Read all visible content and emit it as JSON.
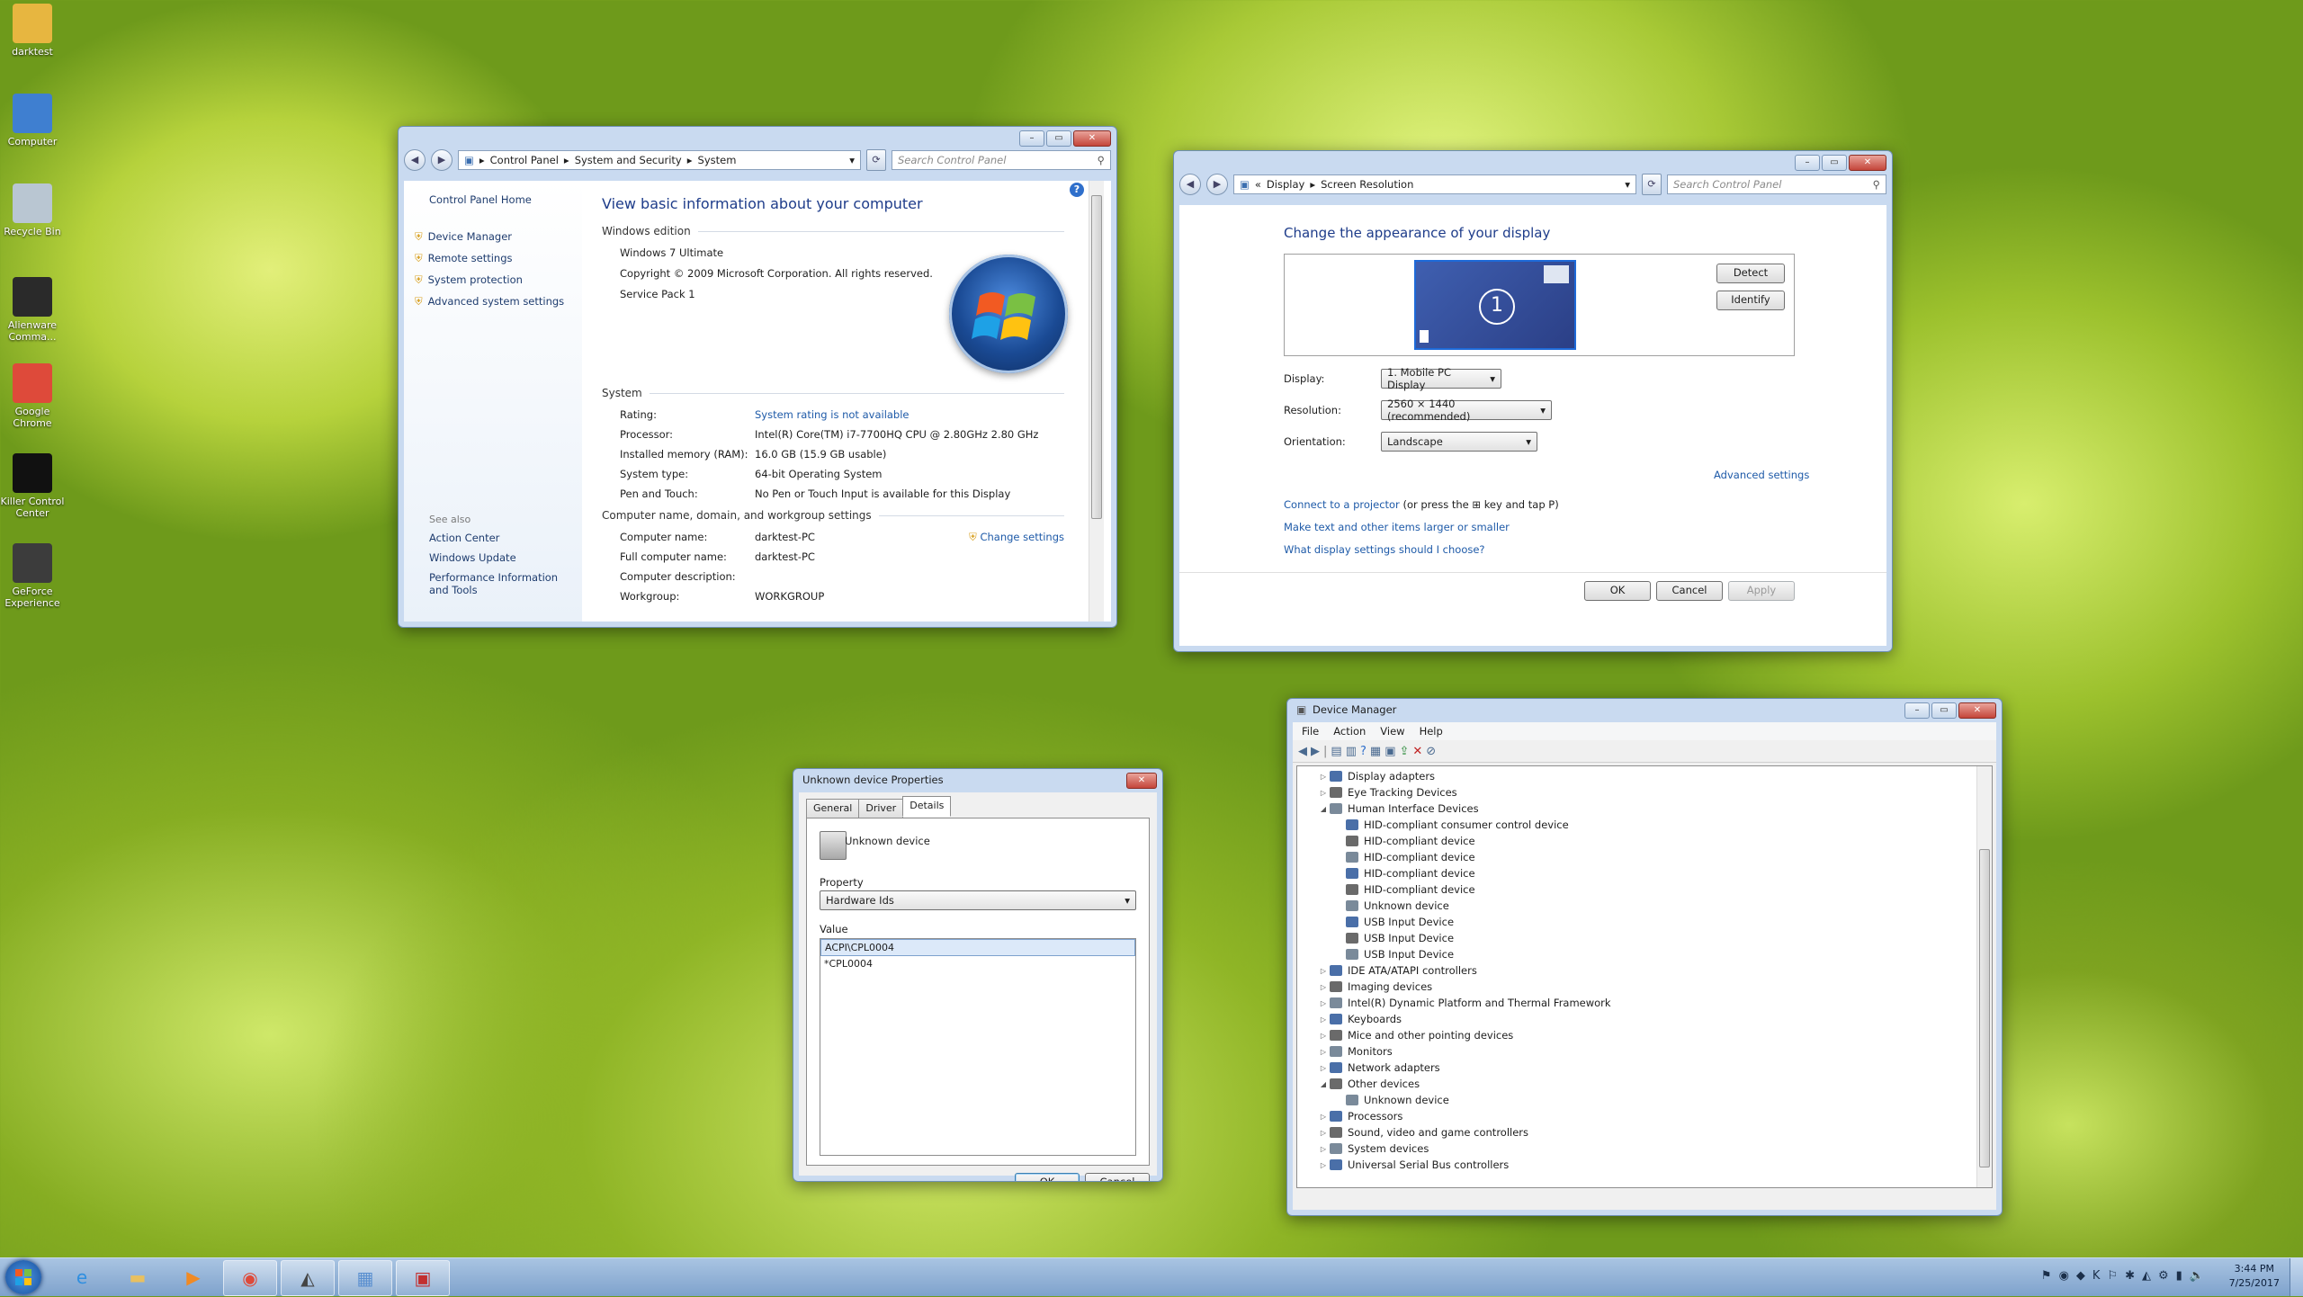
{
  "desktop_icons": [
    {
      "label": "darktest",
      "icon": "user-folder-icon",
      "color": "#e7b640"
    },
    {
      "label": "Computer",
      "icon": "computer-icon",
      "color": "#3f7fd0"
    },
    {
      "label": "Recycle Bin",
      "icon": "recycle-bin-icon",
      "color": "#b9c6d2"
    },
    {
      "label": "Alienware Comma...",
      "icon": "alienware-icon",
      "color": "#2a2a2a"
    },
    {
      "label": "Google Chrome",
      "icon": "chrome-icon",
      "color": "#de4a3a"
    },
    {
      "label": "Killer Control Center",
      "icon": "killer-icon",
      "color": "#111111"
    },
    {
      "label": "GeForce Experience",
      "icon": "geforce-icon",
      "color": "#3c3c3c"
    }
  ],
  "system_window": {
    "breadcrumb": [
      "Control Panel",
      "System and Security",
      "System"
    ],
    "search_placeholder": "Search Control Panel",
    "sidebar_home": "Control Panel Home",
    "sidebar_links": [
      "Device Manager",
      "Remote settings",
      "System protection",
      "Advanced system settings"
    ],
    "see_also_title": "See also",
    "see_also_links": [
      "Action Center",
      "Windows Update",
      "Performance Information and Tools"
    ],
    "heading": "View basic information about your computer",
    "edition_title": "Windows edition",
    "edition_lines": [
      "Windows 7 Ultimate",
      "Copyright © 2009 Microsoft Corporation.  All rights reserved.",
      "Service Pack 1"
    ],
    "system_title": "System",
    "system_rows": [
      {
        "k": "Rating:",
        "v": "System rating is not available",
        "link": true
      },
      {
        "k": "Processor:",
        "v": "Intel(R) Core(TM) i7-7700HQ CPU @ 2.80GHz   2.80 GHz",
        "link": false
      },
      {
        "k": "Installed memory (RAM):",
        "v": "16.0 GB (15.9 GB usable)",
        "link": false
      },
      {
        "k": "System type:",
        "v": "64-bit Operating System",
        "link": false
      },
      {
        "k": "Pen and Touch:",
        "v": "No Pen or Touch Input is available for this Display",
        "link": false
      }
    ],
    "computer_title": "Computer name, domain, and workgroup settings",
    "change_settings": "Change settings",
    "computer_rows": [
      {
        "k": "Computer name:",
        "v": "darktest-PC"
      },
      {
        "k": "Full computer name:",
        "v": "darktest-PC"
      },
      {
        "k": "Computer description:",
        "v": ""
      },
      {
        "k": "Workgroup:",
        "v": "WORKGROUP"
      }
    ]
  },
  "display_window": {
    "breadcrumb": [
      "Display",
      "Screen Resolution"
    ],
    "search_placeholder": "Search Control Panel",
    "heading": "Change the appearance of your display",
    "monitor_number": "1",
    "detect": "Detect",
    "identify": "Identify",
    "display_label": "Display:",
    "display_value": "1. Mobile PC Display",
    "resolution_label": "Resolution:",
    "resolution_value": "2560 × 1440 (recommended)",
    "orientation_label": "Orientation:",
    "orientation_value": "Landscape",
    "advanced": "Advanced settings",
    "projector_link": "Connect to a projector",
    "projector_rest_a": "(or press the",
    "projector_rest_b": "key and tap P)",
    "link2": "Make text and other items larger or smaller",
    "link3": "What display settings should I choose?",
    "ok": "OK",
    "cancel": "Cancel",
    "apply": "Apply"
  },
  "props_window": {
    "title": "Unknown device Properties",
    "tabs": [
      "General",
      "Driver",
      "Details"
    ],
    "active_tab": "Details",
    "device_name": "Unknown device",
    "property_label": "Property",
    "property_value": "Hardware Ids",
    "value_label": "Value",
    "values": [
      "ACPI\\CPL0004",
      "*CPL0004"
    ],
    "ok": "OK",
    "cancel": "Cancel"
  },
  "devmgr_window": {
    "title": "Device Manager",
    "menu": [
      "File",
      "Action",
      "View",
      "Help"
    ],
    "tree": [
      {
        "label": "Display adapters",
        "level": 0,
        "toggle": "▷"
      },
      {
        "label": "Eye Tracking Devices",
        "level": 0,
        "toggle": "▷"
      },
      {
        "label": "Human Interface Devices",
        "level": 0,
        "toggle": "◢"
      },
      {
        "label": "HID-compliant consumer control device",
        "level": 1,
        "toggle": ""
      },
      {
        "label": "HID-compliant device",
        "level": 1,
        "toggle": ""
      },
      {
        "label": "HID-compliant device",
        "level": 1,
        "toggle": ""
      },
      {
        "label": "HID-compliant device",
        "level": 1,
        "toggle": ""
      },
      {
        "label": "HID-compliant device",
        "level": 1,
        "toggle": ""
      },
      {
        "label": "Unknown device",
        "level": 1,
        "toggle": ""
      },
      {
        "label": "USB Input Device",
        "level": 1,
        "toggle": ""
      },
      {
        "label": "USB Input Device",
        "level": 1,
        "toggle": ""
      },
      {
        "label": "USB Input Device",
        "level": 1,
        "toggle": ""
      },
      {
        "label": "IDE ATA/ATAPI controllers",
        "level": 0,
        "toggle": "▷"
      },
      {
        "label": "Imaging devices",
        "level": 0,
        "toggle": "▷"
      },
      {
        "label": "Intel(R) Dynamic Platform and Thermal Framework",
        "level": 0,
        "toggle": "▷"
      },
      {
        "label": "Keyboards",
        "level": 0,
        "toggle": "▷"
      },
      {
        "label": "Mice and other pointing devices",
        "level": 0,
        "toggle": "▷"
      },
      {
        "label": "Monitors",
        "level": 0,
        "toggle": "▷"
      },
      {
        "label": "Network adapters",
        "level": 0,
        "toggle": "▷"
      },
      {
        "label": "Other devices",
        "level": 0,
        "toggle": "◢"
      },
      {
        "label": "Unknown device",
        "level": 1,
        "toggle": ""
      },
      {
        "label": "Processors",
        "level": 0,
        "toggle": "▷"
      },
      {
        "label": "Sound, video and game controllers",
        "level": 0,
        "toggle": "▷"
      },
      {
        "label": "System devices",
        "level": 0,
        "toggle": "▷"
      },
      {
        "label": "Universal Serial Bus controllers",
        "level": 0,
        "toggle": "▷"
      }
    ]
  },
  "taskbar": {
    "apps": [
      {
        "name": "internet-explorer-icon",
        "glyph": "e",
        "color": "#2f8fe0"
      },
      {
        "name": "explorer-folder-icon",
        "glyph": "▬",
        "color": "#e8c060"
      },
      {
        "name": "media-player-icon",
        "glyph": "▶",
        "color": "#f08a24"
      },
      {
        "name": "chrome-icon",
        "glyph": "◉",
        "color": "#de4a3a"
      },
      {
        "name": "alienware-icon",
        "glyph": "◭",
        "color": "#444444"
      },
      {
        "name": "control-panel-icon",
        "glyph": "▦",
        "color": "#5a8fd0"
      },
      {
        "name": "device-manager-icon",
        "glyph": "▣",
        "color": "#c23030"
      }
    ],
    "time": "3:44 PM",
    "date": "7/25/2017"
  }
}
